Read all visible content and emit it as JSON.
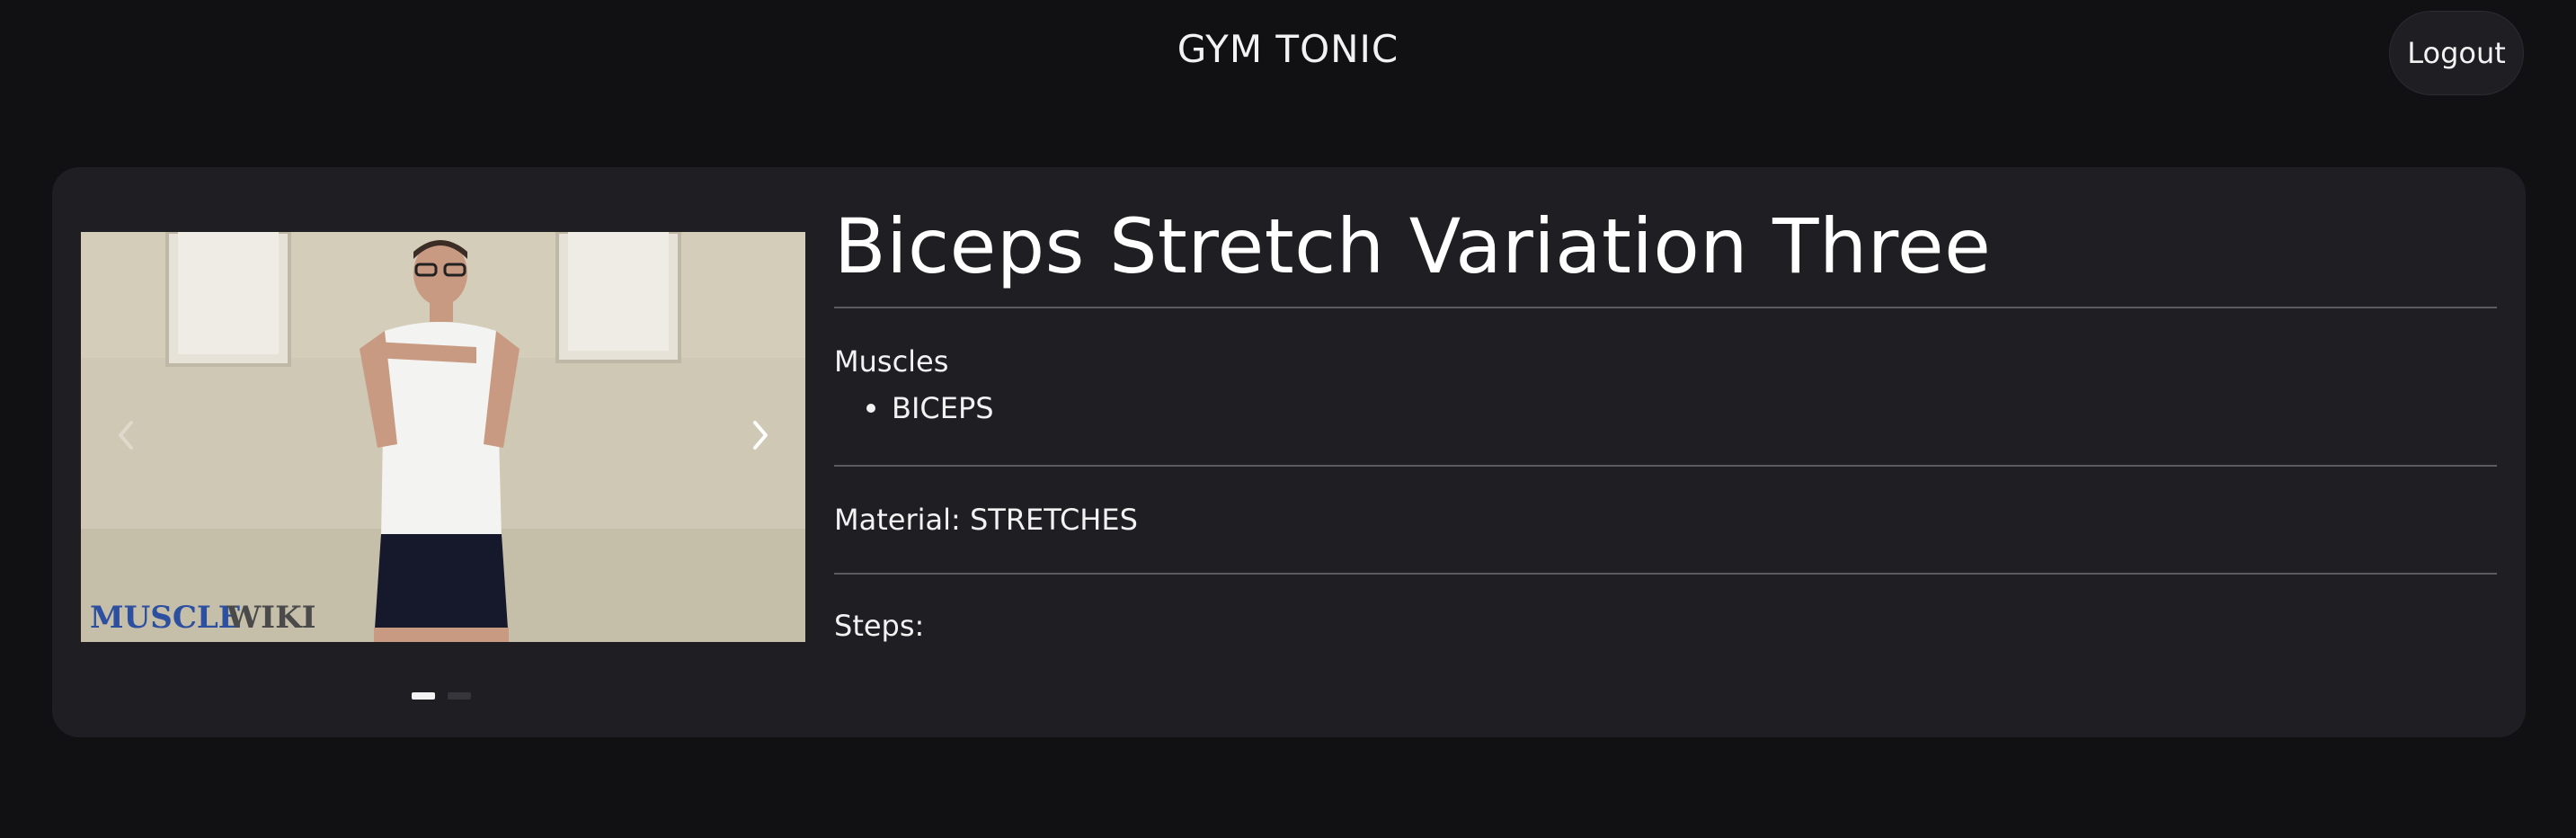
{
  "header": {
    "app_title": "GYM TONIC",
    "logout_label": "Logout"
  },
  "carousel": {
    "watermark_brand_a": "MUSCLE",
    "watermark_brand_b": "WIKI",
    "prev_icon": "chevron-left-icon",
    "next_icon": "chevron-right-icon",
    "slide_count": 2,
    "active_slide": 1
  },
  "exercise": {
    "title": "Biceps Stretch Variation Three",
    "muscles_label": "Muscles",
    "muscles": [
      "BICEPS"
    ],
    "material_text": "Material: STRETCHES",
    "steps_label": "Steps:"
  },
  "colors": {
    "background": "#111114",
    "card": "#1f1e22",
    "text": "#f2f2f2",
    "watermark_blue": "#2d4fa0",
    "watermark_grey": "#4a4a4a"
  }
}
